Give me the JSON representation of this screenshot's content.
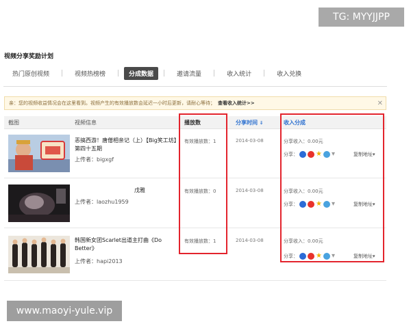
{
  "watermarks": {
    "top": "TG: MYYJJPP",
    "bottom": "www.maoyi-yule.vip"
  },
  "page": {
    "title": "视频分享奖励计划"
  },
  "tabs": [
    {
      "label": "热门原创视频"
    },
    {
      "label": "视频热榜榜"
    },
    {
      "label": "分成数据"
    },
    {
      "label": "邀请流量"
    },
    {
      "label": "收入统计"
    },
    {
      "label": "收入兑换"
    }
  ],
  "notice": {
    "text": "亲：您的视频收益情况会在这里看到。视频产生的有效播放数会延迟一小时后更新，请耐心等待；",
    "link": "查看收入统计>>",
    "close": "✕"
  },
  "table": {
    "headers": {
      "thumb": "截图",
      "info": "视频信息",
      "plays": "播放数",
      "share_time": "分享时间",
      "sort_arrow": "⇓",
      "income": "收入分成"
    },
    "rows": [
      {
        "title": "恶搞西游！唐僧相亲记（上）【Big笑工坊】第四十五期",
        "uploader": "上传者：bigxgf",
        "plays": "有效播放数：1",
        "date": "2014-03-08",
        "income": "分享收入：0.00元",
        "share_label": "分享：",
        "copy": "复制地址▾"
      },
      {
        "title": "戊雅",
        "uploader": "上传者：laozhu1959",
        "plays": "有效播放数：0",
        "date": "2014-03-08",
        "income": "分享收入：0.00元",
        "share_label": "分享：",
        "copy": "复制地址▾"
      },
      {
        "title": "韩国新女团Scarlet出道主打曲《Do Better》",
        "uploader": "上传者：hapi2013",
        "plays": "有效播放数：1",
        "date": "2014-03-08",
        "income": "分享收入：0.00元",
        "share_label": "分享：",
        "copy": "复制地址▾"
      }
    ]
  },
  "colors": {
    "highlight": "#e3232c",
    "accent_blue": "#2a6fcf",
    "active_tab": "#4a4a4a"
  }
}
